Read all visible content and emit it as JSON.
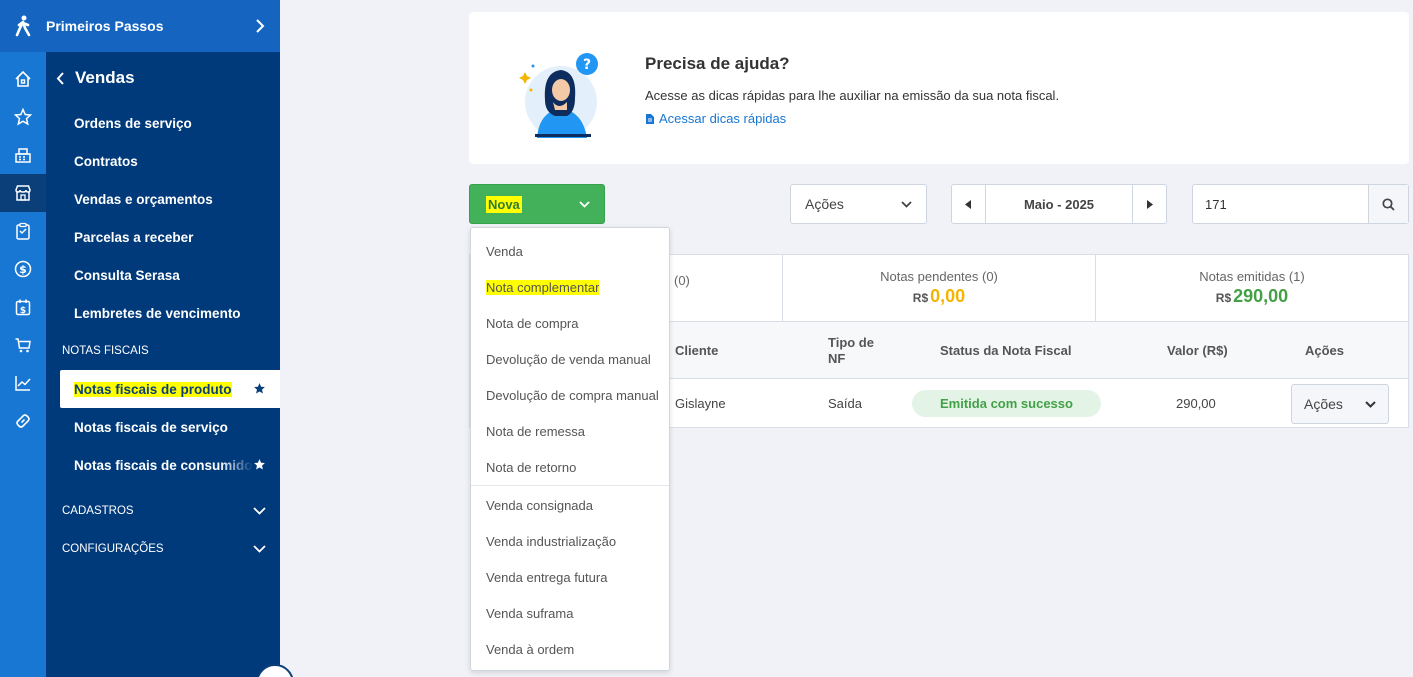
{
  "topbar": {
    "title": "Primeiros Passos"
  },
  "rail": {
    "icons": [
      "home-icon",
      "star-icon",
      "register-icon",
      "store-icon",
      "clipboard-icon",
      "dollar-icon",
      "calendar-dollar-icon",
      "cart-icon",
      "chart-icon",
      "link-icon"
    ]
  },
  "menu": {
    "back_label": "Vendas",
    "items": [
      "Ordens de serviço",
      "Contratos",
      "Vendas e orçamentos",
      "Parcelas a receber",
      "Consulta Serasa",
      "Lembretes de vencimento"
    ],
    "section_notas": "NOTAS FISCAIS",
    "notas": {
      "produto": "Notas fiscais de produto",
      "servico": "Notas fiscais de serviço",
      "consumidor": "Notas fiscais de consumidor"
    },
    "section_cadastros": "CADASTROS",
    "section_config": "CONFIGURAÇÕES"
  },
  "help": {
    "title": "Precisa de ajuda?",
    "text": "Acesse as dicas rápidas para lhe auxiliar na emissão da sua nota fiscal.",
    "link": "Acessar dicas rápidas"
  },
  "toolbar": {
    "nova": "Nova",
    "acoes": "Ações",
    "month": "Maio - 2025",
    "search_value": "171"
  },
  "summary": {
    "first_caption": "(0)",
    "pendentes_caption": "Notas pendentes (0)",
    "pendentes_currency": "R$",
    "pendentes_value": "0,00",
    "emitidas_caption": "Notas emitidas (1)",
    "emitidas_currency": "R$",
    "emitidas_value": "290,00"
  },
  "table": {
    "headers": {
      "cliente": "Cliente",
      "tipo_1": "Tipo de",
      "tipo_2": "NF",
      "status": "Status da Nota Fiscal",
      "valor": "Valor (R$)",
      "acoes": "Ações"
    },
    "rows": [
      {
        "cliente": "Gislayne",
        "tipo": "Saída",
        "status": "Emitida com sucesso",
        "valor": "290,00",
        "acoes": "Ações"
      }
    ]
  },
  "dropdown": {
    "group1": [
      "Venda",
      "Nota complementar",
      "Nota de compra",
      "Devolução de venda manual",
      "Devolução de compra manual",
      "Nota de remessa",
      "Nota de retorno"
    ],
    "group2": [
      "Venda consignada",
      "Venda industrialização",
      "Venda entrega futura",
      "Venda suframa",
      "Venda à ordem"
    ]
  },
  "colors": {
    "green": "#43b05a",
    "highlight": "#ffff00",
    "sidebar": "#003a7a",
    "rail": "#1877d2"
  }
}
